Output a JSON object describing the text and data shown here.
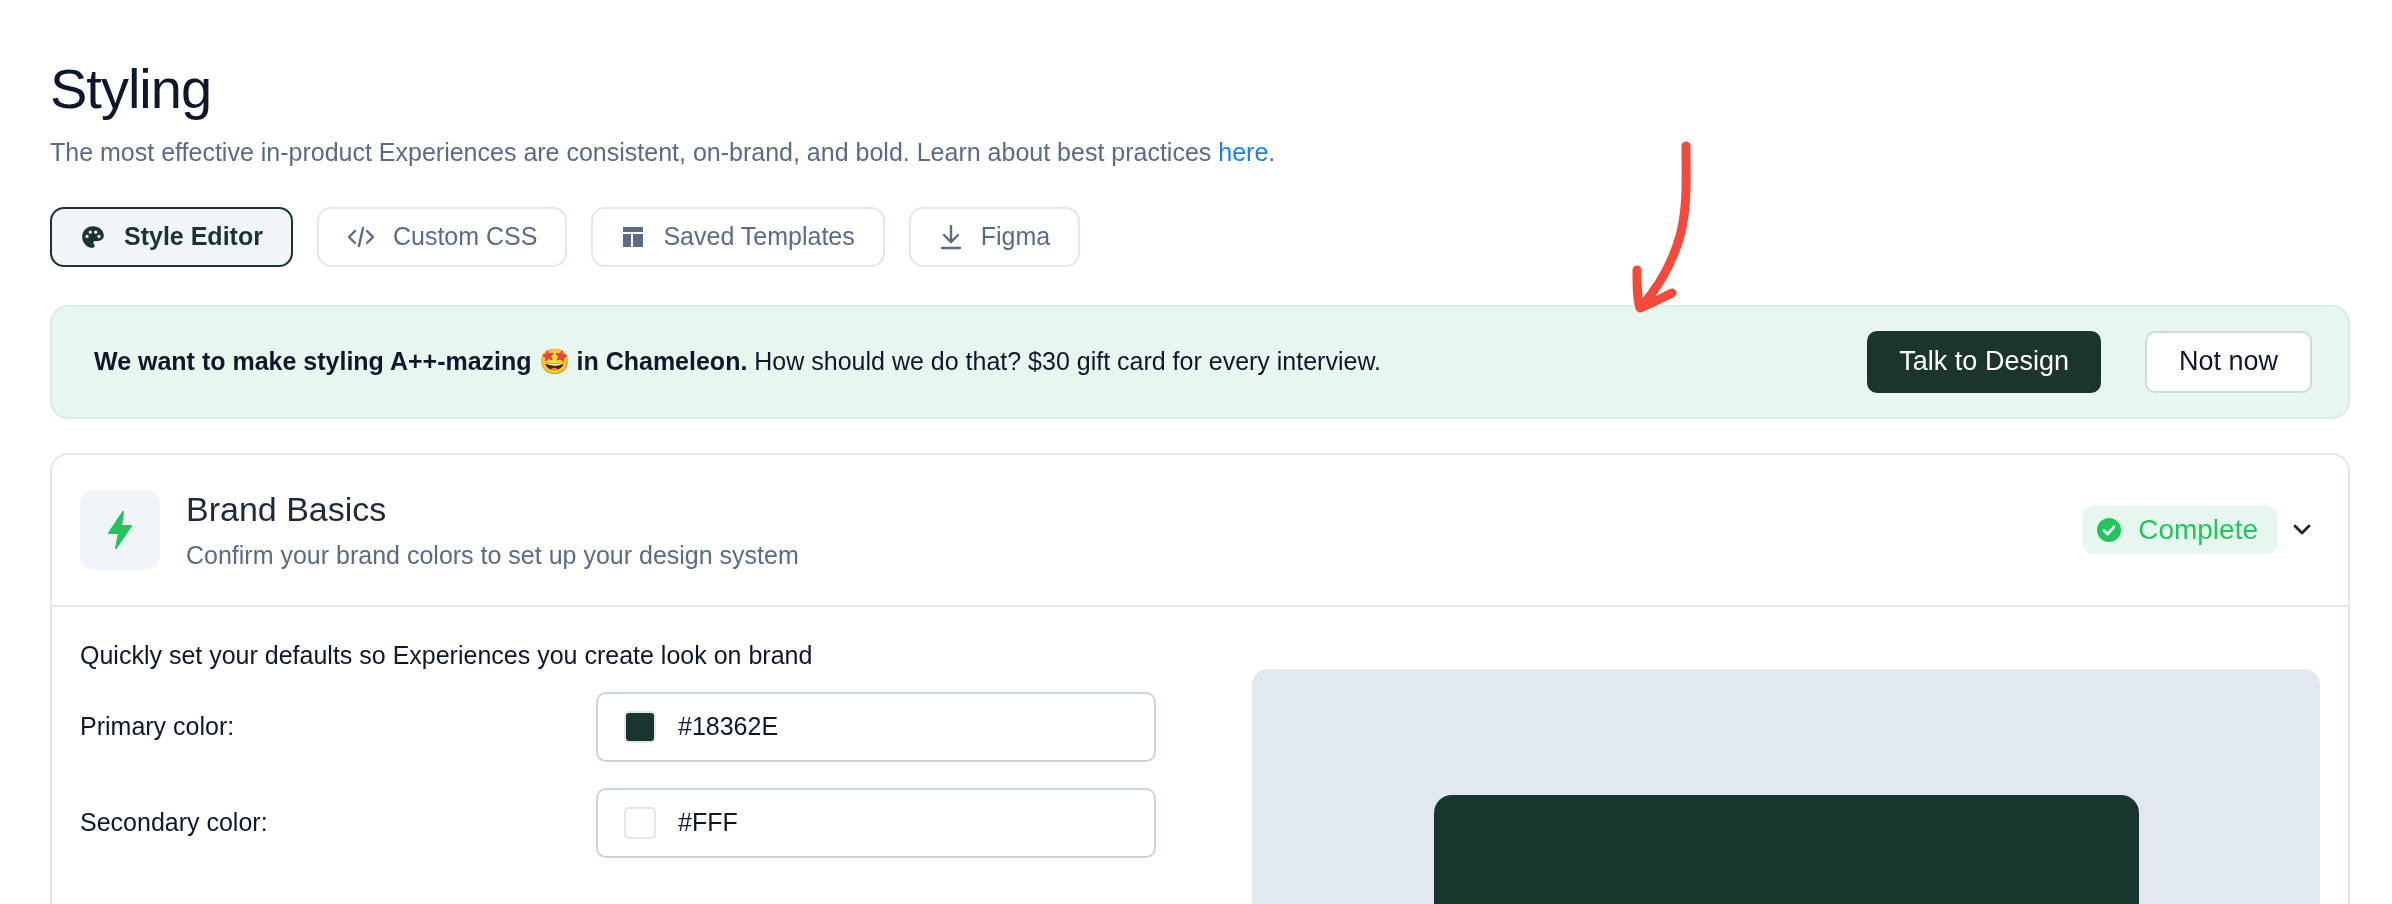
{
  "header": {
    "title": "Styling",
    "subtitle": "The most effective in-product Experiences are consistent, on-brand, and bold. Learn about best practices ",
    "link": "here",
    "after_link": "."
  },
  "tabs": [
    {
      "label": "Style Editor",
      "kind": "palette",
      "selected": true
    },
    {
      "label": "Custom CSS",
      "kind": "code",
      "selected": false
    },
    {
      "label": "Saved Templates",
      "kind": "template",
      "selected": false
    },
    {
      "label": "Figma",
      "kind": "download",
      "selected": false
    }
  ],
  "banner": {
    "text": "**We want to make styling A++-mazing 🤩 in Chameleon.** How should we do that? $30 gift card for every interview.",
    "primary_button": "Talk to Design",
    "secondary_button": "Not now"
  },
  "section": {
    "title": "Brand Basics",
    "subtitle": "Confirm your brand colors to set up your design system",
    "status": {
      "label": "Complete",
      "complete": true
    },
    "expanded": true,
    "intro": "Quickly set your defaults so Experiences you create look on brand",
    "fields": [
      {
        "label": "Primary color:",
        "value": "#18362E"
      },
      {
        "label": "Secondary color:",
        "value": "#FFF"
      }
    ]
  }
}
